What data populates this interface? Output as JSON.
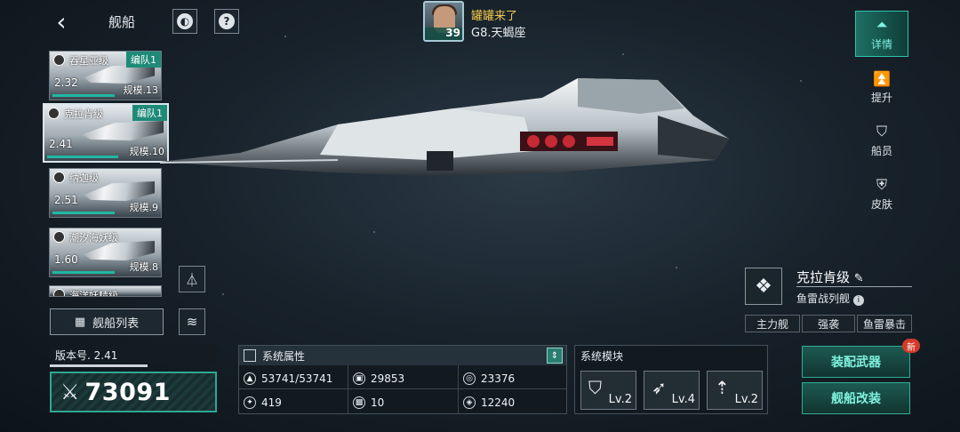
{
  "header": {
    "title": "舰船"
  },
  "player": {
    "name": "罐罐来了",
    "zone": "G8.天蝎座",
    "level": "39"
  },
  "ships": [
    {
      "name": "吞星亚级",
      "fleet": "编队1",
      "value": "2.32",
      "scale": "规模.13"
    },
    {
      "name": "克拉肯级",
      "fleet": "编队1",
      "value": "2.41",
      "scale": "规模.10"
    },
    {
      "name": "纳迦级",
      "fleet": "",
      "value": "2.51",
      "scale": "规模.9"
    },
    {
      "name": "潮汐海妖级",
      "fleet": "",
      "value": "1.60",
      "scale": "规模.8"
    },
    {
      "name": "海洋妖精级",
      "fleet": "",
      "value": "",
      "scale": ""
    }
  ],
  "list_button": "舰船列表",
  "right_tabs": [
    {
      "label": "详情",
      "icon": "ship-detail-icon"
    },
    {
      "label": "提升",
      "icon": "upgrade-icon"
    },
    {
      "label": "船员",
      "icon": "crew-icon"
    },
    {
      "label": "皮肤",
      "icon": "skin-icon"
    }
  ],
  "selected_ship": {
    "name": "克拉肯级",
    "type": "鱼雷战列舰",
    "roles": [
      "主力舰",
      "强袭",
      "鱼雷暴击"
    ]
  },
  "version": {
    "label": "版本号. 2.41"
  },
  "power": "73091",
  "attributes": {
    "title": "系统属性",
    "items": [
      {
        "icon": "hull-icon",
        "value": "53741/53741"
      },
      {
        "icon": "armor-icon",
        "value": "29853"
      },
      {
        "icon": "shield-icon",
        "value": "23376"
      },
      {
        "icon": "energy-icon",
        "value": "419"
      },
      {
        "icon": "grid-icon",
        "value": "10"
      },
      {
        "icon": "target-icon",
        "value": "12240"
      }
    ]
  },
  "modules": {
    "title": "系统模块",
    "items": [
      {
        "icon": "shield-module-icon",
        "level": "Lv.2"
      },
      {
        "icon": "missile-module-icon",
        "level": "Lv.4"
      },
      {
        "icon": "engine-module-icon",
        "level": "Lv.2"
      }
    ]
  },
  "actions": {
    "equip": "装配武器",
    "modify": "舰船改装",
    "new_badge": "新"
  },
  "colors": {
    "accent": "#2fc3ad",
    "highlight": "#7ff3df",
    "player_name": "#f2c94c",
    "badge": "#d23a2a"
  }
}
